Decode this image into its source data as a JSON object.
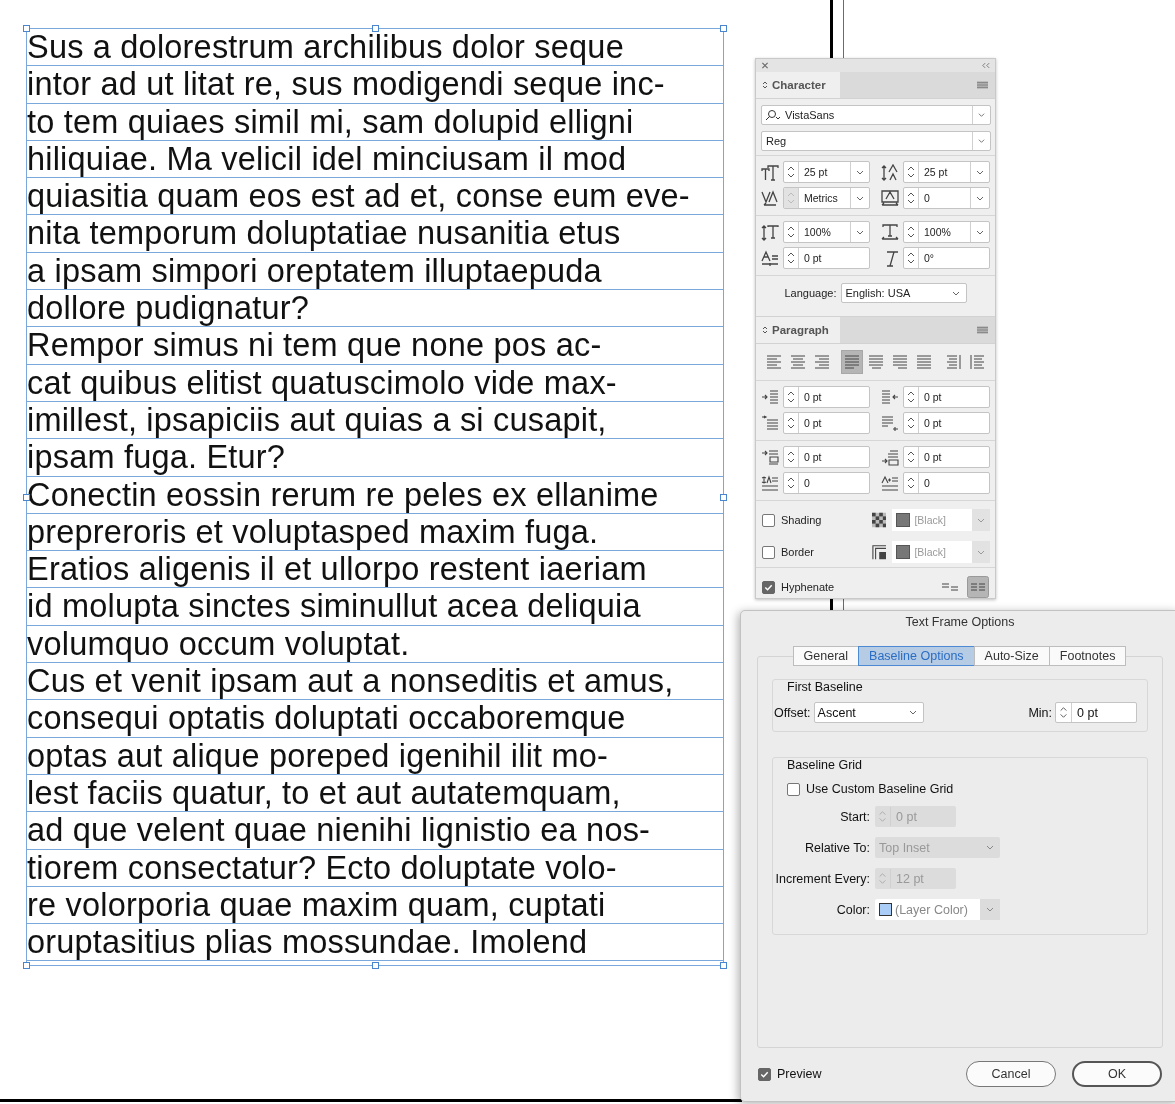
{
  "text_frame": {
    "lines": [
      "Sus a dolorestrum archilibus dolor seque",
      "intor ad ut litat re, sus modigendi seque inc-",
      "to tem quiaes simil mi, sam dolupid elligni",
      "hiliquiae. Ma velicil idel minciusam il mod",
      "quiasitia quam eos est ad et, conse eum eve-",
      "nita temporum doluptatiae nusanitia etus",
      "a ipsam simpori oreptatem illuptaepuda",
      "dollore pudignatur?",
      "Rempor simus ni tem que none pos ac-",
      "cat quibus elitist quatuscimolo vide max-",
      "imillest, ipsapiciis aut quias a si cusapit,",
      "ipsam fuga. Etur?",
      "Conectin eossin rerum re peles ex ellanime",
      "prepreroris et voluptasped maxim fuga.",
      "Eratios aligenis il et ullorpo restent iaeriam",
      "id molupta sinctes siminullut acea deliquia",
      "volumquo occum voluptat.",
      "Cus et venit ipsam aut a nonseditis et amus,",
      "consequi optatis doluptati occaboremque",
      "optas aut alique poreped igenihil ilit mo-",
      "lest faciis quatur, to et aut autatemquam,",
      "ad que velent quae nienihi lignistio ea nos-",
      "tiorem consectatur? Ecto doluptate volo-",
      "re volorporia quae maxim quam, cuptati",
      "oruptasitius plias mossundae. Imolend"
    ]
  },
  "character_panel": {
    "tab": "Character",
    "font_family": "VistaSans",
    "font_style": "Reg",
    "field_groups": [
      [
        {
          "kind": "font-size",
          "value": "25 pt",
          "dropdown": true,
          "stepper_disabled": false
        },
        {
          "kind": "leading",
          "value": "25 pt",
          "dropdown": true,
          "stepper_disabled": false
        },
        {
          "kind": "kerning",
          "value": "Metrics",
          "dropdown": true,
          "stepper_disabled": true
        },
        {
          "kind": "tracking",
          "value": "0",
          "dropdown": true,
          "stepper_disabled": false
        }
      ],
      [
        {
          "kind": "vertical-scale",
          "value": "100%",
          "dropdown": true,
          "stepper_disabled": false
        },
        {
          "kind": "horizontal-scale",
          "value": "100%",
          "dropdown": true,
          "stepper_disabled": false
        },
        {
          "kind": "baseline-shift",
          "value": "0 pt",
          "dropdown": false,
          "stepper_disabled": false
        },
        {
          "kind": "skew",
          "value": "0°",
          "dropdown": false,
          "stepper_disabled": false
        }
      ]
    ],
    "language_label": "Language:",
    "language": "English: USA"
  },
  "paragraph_panel": {
    "tab": "Paragraph",
    "alignments": [
      {
        "kind": "left",
        "selected": false
      },
      {
        "kind": "center",
        "selected": false
      },
      {
        "kind": "right",
        "selected": false
      },
      {
        "kind": "justify-left",
        "selected": true
      },
      {
        "kind": "justify-center",
        "selected": false
      },
      {
        "kind": "justify-right",
        "selected": false
      },
      {
        "kind": "justify-all",
        "selected": false
      },
      {
        "kind": "toward-spine",
        "selected": false
      },
      {
        "kind": "away-spine",
        "selected": false
      }
    ],
    "field_groups": [
      [
        {
          "kind": "left-indent",
          "value": "0 pt",
          "dropdown": false,
          "stepper_disabled": false
        },
        {
          "kind": "right-indent",
          "value": "0 pt",
          "dropdown": false,
          "stepper_disabled": false
        },
        {
          "kind": "first-line-indent",
          "value": "0 pt",
          "dropdown": false,
          "stepper_disabled": false
        },
        {
          "kind": "last-line-indent",
          "value": "0 pt",
          "dropdown": false,
          "stepper_disabled": false
        }
      ],
      [
        {
          "kind": "space-before",
          "value": "0 pt",
          "dropdown": false,
          "stepper_disabled": false
        },
        {
          "kind": "space-after",
          "value": "0 pt",
          "dropdown": false,
          "stepper_disabled": false
        },
        {
          "kind": "drop-cap-lines",
          "value": "0",
          "dropdown": false,
          "stepper_disabled": false
        },
        {
          "kind": "drop-cap-chars",
          "value": "0",
          "dropdown": false,
          "stepper_disabled": false
        }
      ]
    ],
    "options": [
      {
        "kind": "shading",
        "label": "Shading",
        "checked": false,
        "swatch": "[Black]"
      },
      {
        "kind": "border",
        "label": "Border",
        "checked": false,
        "swatch": "[Black]"
      }
    ],
    "hyphenate": {
      "label": "Hyphenate",
      "checked": true
    },
    "compose_modes": [
      {
        "selected": false
      },
      {
        "selected": true
      }
    ]
  },
  "dialog": {
    "title": "Text Frame Options",
    "tabs": [
      {
        "label": "General",
        "selected": false
      },
      {
        "label": "Baseline Options",
        "selected": true
      },
      {
        "label": "Auto-Size",
        "selected": false
      },
      {
        "label": "Footnotes",
        "selected": false
      }
    ],
    "first_baseline": {
      "title": "First Baseline",
      "offset_label": "Offset:",
      "offset": "Ascent",
      "min_label": "Min:",
      "min": "0 pt"
    },
    "baseline_grid": {
      "title": "Baseline Grid",
      "use_custom": {
        "label": "Use Custom Baseline Grid",
        "checked": false
      },
      "rows": [
        {
          "kind": "stepper",
          "label": "Start:",
          "value": "0 pt",
          "disabled": true
        },
        {
          "kind": "dropdown",
          "label": "Relative To:",
          "value": "Top Inset",
          "disabled": true
        },
        {
          "kind": "stepper",
          "label": "Increment Every:",
          "value": "12 pt",
          "disabled": true
        },
        {
          "kind": "color",
          "label": "Color:",
          "value": "(Layer Color)",
          "disabled": false,
          "color": "#a9cdf7"
        }
      ]
    },
    "preview": {
      "label": "Preview",
      "checked": true
    },
    "buttons": [
      {
        "label": "Cancel",
        "default": false
      },
      {
        "label": "OK",
        "default": true
      }
    ]
  }
}
